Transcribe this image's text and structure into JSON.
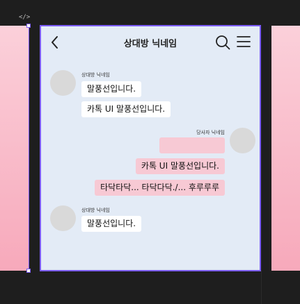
{
  "editor": {
    "frame_tag": "</>"
  },
  "chat": {
    "title": "상대방 닉네임",
    "icons": {
      "back": "chevron-left-icon",
      "search": "search-icon",
      "menu": "hamburger-menu-icon"
    },
    "colors": {
      "accent": "#7b5cf5",
      "background": "#e3ebf6",
      "received_bubble": "#ffffff",
      "sent_bubble": "#f7c9d4",
      "avatar": "#d9d9d9"
    },
    "groups": [
      {
        "sender": "상대방 닉네임",
        "messages": [
          "말풍선입니다.",
          "카톡 UI 말풍선입니다."
        ]
      },
      {
        "sender": "당사자 닉네임",
        "messages": [
          "",
          "카톡 UI 말풍선입니다.",
          "타닥타닥... 타닥다닥./... 후루루루"
        ]
      },
      {
        "sender": "상대방 닉네임",
        "messages": [
          "말풍선입니다."
        ]
      }
    ]
  }
}
